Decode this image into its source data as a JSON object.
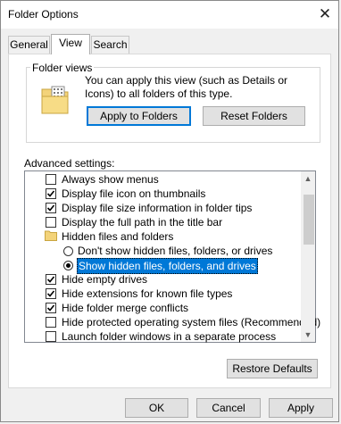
{
  "window": {
    "title": "Folder Options",
    "close_glyph": "✕"
  },
  "tabs": [
    {
      "label": "General",
      "active": false
    },
    {
      "label": "View",
      "active": true
    },
    {
      "label": "Search",
      "active": false
    }
  ],
  "folder_views": {
    "label": "Folder views",
    "description": "You can apply this view (such as Details or Icons) to all folders of this type.",
    "apply_button": "Apply to Folders",
    "reset_button": "Reset Folders"
  },
  "advanced": {
    "label": "Advanced settings:",
    "items": [
      {
        "kind": "checkbox",
        "label": "Always show menus",
        "checked": false
      },
      {
        "kind": "checkbox",
        "label": "Display file icon on thumbnails",
        "checked": true
      },
      {
        "kind": "checkbox",
        "label": "Display file size information in folder tips",
        "checked": true
      },
      {
        "kind": "checkbox",
        "label": "Display the full path in the title bar",
        "checked": false
      },
      {
        "kind": "folder",
        "label": "Hidden files and folders"
      },
      {
        "kind": "radio",
        "label": "Don't show hidden files, folders, or drives",
        "checked": false
      },
      {
        "kind": "radio",
        "label": "Show hidden files, folders, and drives",
        "checked": true,
        "selected": true
      },
      {
        "kind": "checkbox",
        "label": "Hide empty drives",
        "checked": true
      },
      {
        "kind": "checkbox",
        "label": "Hide extensions for known file types",
        "checked": true
      },
      {
        "kind": "checkbox",
        "label": "Hide folder merge conflicts",
        "checked": true
      },
      {
        "kind": "checkbox",
        "label": "Hide protected operating system files (Recommended)",
        "checked": false
      },
      {
        "kind": "checkbox",
        "label": "Launch folder windows in a separate process",
        "checked": false
      }
    ],
    "scroll_up_glyph": "▲",
    "scroll_down_glyph": "▼",
    "restore_button": "Restore Defaults"
  },
  "footer": {
    "ok": "OK",
    "cancel": "Cancel",
    "apply": "Apply"
  },
  "colors": {
    "selection": "#0078d7",
    "folder": "#f3d37a",
    "accent_border": "#0078d7"
  },
  "icons": {
    "folder_views": "folder-icon",
    "checkbox_mark": "checkmark-icon"
  }
}
